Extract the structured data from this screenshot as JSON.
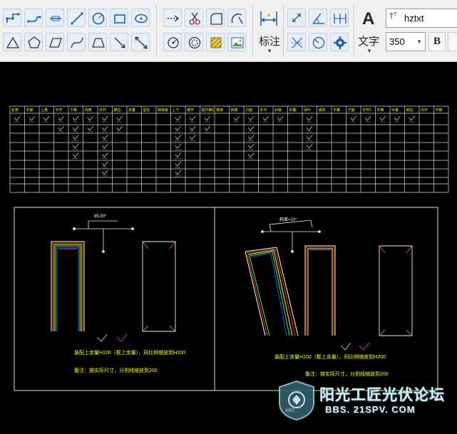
{
  "ribbon": {
    "dimension_label": "标注",
    "text_label": "文字",
    "font_name": "hztxt",
    "font_size": "350",
    "bold_label": "B",
    "big_a": "A"
  },
  "drawing": {
    "table_headers": [
      "名称",
      "天窗",
      "上悬",
      "平开",
      "下悬",
      "内倒",
      "外开",
      "推拉",
      "折叠",
      "固定",
      "转换窗",
      "上下",
      "推开",
      "提升推拉",
      "玻璃",
      "转角",
      "凸窗",
      "外平",
      "纱窗",
      "外翻",
      "百叶",
      "通风",
      "平推",
      "下旋",
      "平开2",
      "外推",
      "中悬",
      "斜拉",
      "内平",
      "平移"
    ],
    "left_angle_label": "85.00°",
    "right_angle_label": "斜度=10°",
    "left_caption_1": "装配上余量H100（框上余量），同比例缩放到H200",
    "left_caption_2": "备注：按实际尺寸，分割线缩放到200",
    "right_caption_1": "装配上余量H100（框上余量），同比例缩放到H200",
    "right_caption_2": "备注：按实际尺寸，分割线缩放到200"
  },
  "watermark": {
    "text": "阳光工匠光伏论坛",
    "url": "BBS. 21SPV. COM",
    "year": "2007"
  }
}
